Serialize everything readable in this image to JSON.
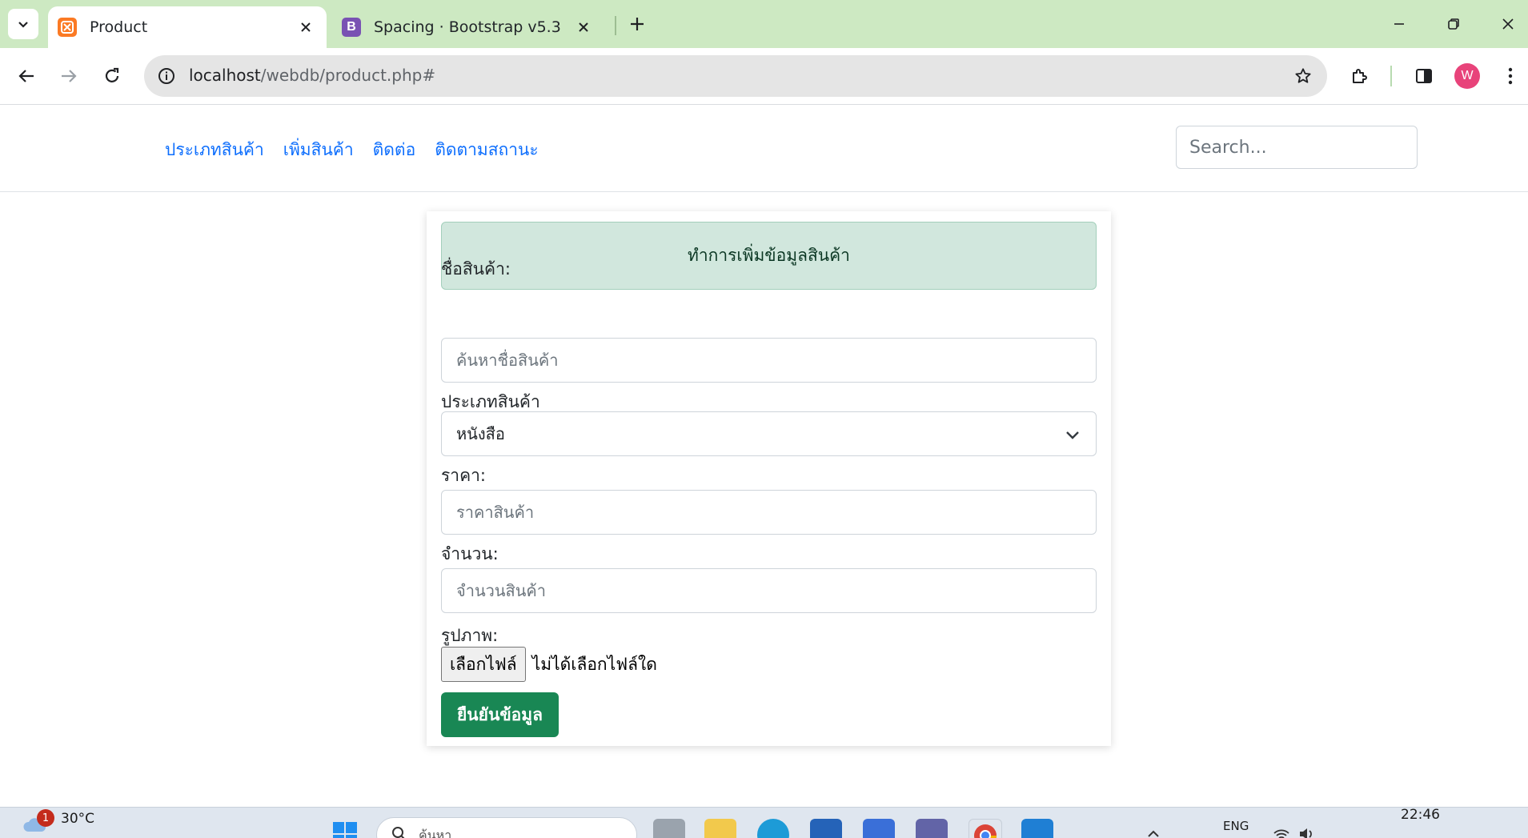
{
  "browser": {
    "tabs": [
      {
        "title": "Product",
        "active": true,
        "favicon": "xampp-icon"
      },
      {
        "title": "Spacing · Bootstrap v5.3",
        "active": false,
        "favicon": "bootstrap-icon",
        "favicon_letter": "B"
      }
    ],
    "url_host": "localhost",
    "url_path": "/webdb/product.php#",
    "avatar_letter": "W"
  },
  "nav": {
    "links": [
      "ประเภทสินค้า",
      "เพิ่มสินค้า",
      "ติดต่อ",
      "ติดตามสถานะ"
    ],
    "search_placeholder": "Search..."
  },
  "form": {
    "alert": "ทำการเพิ่มข้อมูลสินค้า",
    "name_label": "ชื่อสินค้า:",
    "name_placeholder": "ค้นหาชื่อสินค้า",
    "type_label": "ประเภทสินค้า",
    "type_selected": "หนังสือ",
    "price_label": "ราคา:",
    "price_placeholder": "ราคาสินค้า",
    "qty_label": "จำนวน:",
    "qty_placeholder": "จำนวนสินค้า",
    "image_label": "รูปภาพ:",
    "file_button": "เลือกไฟล์",
    "file_status": "ไม่ได้เลือกไฟล์ใด",
    "submit": "ยืนยันข้อมูล"
  },
  "taskbar": {
    "weather_badge": "1",
    "temperature": "30°C",
    "search_text": "ค้นหา",
    "language": "ENG",
    "time": "22:46"
  },
  "colors": {
    "tabstrip": "#cde9c2",
    "link": "#0d6efd",
    "alert_bg": "#d1e7dd",
    "submit_bg": "#198754"
  }
}
